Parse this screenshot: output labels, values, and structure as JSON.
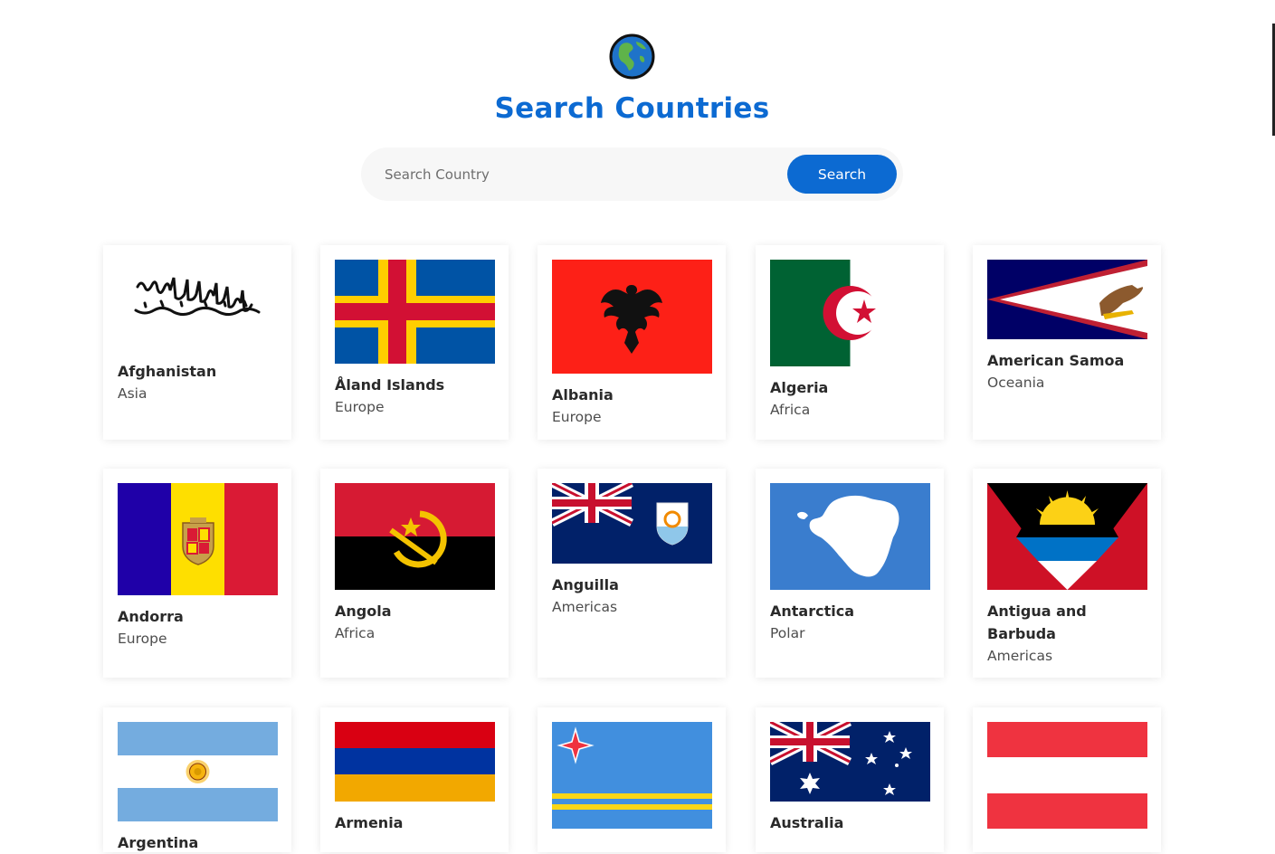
{
  "app": {
    "globe_icon": "globe-americas-icon",
    "title": "Search Countries"
  },
  "search": {
    "placeholder": "Search Country",
    "value": "",
    "button_label": "Search"
  },
  "colors": {
    "accent": "#0c6ad2",
    "search_bg": "#f7f7f7"
  },
  "countries": [
    {
      "name": "Afghanistan",
      "region": "Asia",
      "flag": "afghanistan-flag"
    },
    {
      "name": "Åland Islands",
      "region": "Europe",
      "flag": "aland-islands-flag"
    },
    {
      "name": "Albania",
      "region": "Europe",
      "flag": "albania-flag"
    },
    {
      "name": "Algeria",
      "region": "Africa",
      "flag": "algeria-flag"
    },
    {
      "name": "American Samoa",
      "region": "Oceania",
      "flag": "american-samoa-flag"
    },
    {
      "name": "Andorra",
      "region": "Europe",
      "flag": "andorra-flag"
    },
    {
      "name": "Angola",
      "region": "Africa",
      "flag": "angola-flag"
    },
    {
      "name": "Anguilla",
      "region": "Americas",
      "flag": "anguilla-flag"
    },
    {
      "name": "Antarctica",
      "region": "Polar",
      "flag": "antarctica-flag"
    },
    {
      "name": "Antigua and Barbuda",
      "region": "Americas",
      "flag": "antigua-and-barbuda-flag"
    },
    {
      "name": "Argentina",
      "region": "",
      "flag": "argentina-flag"
    },
    {
      "name": "Armenia",
      "region": "",
      "flag": "armenia-flag"
    },
    {
      "name": "",
      "region": "",
      "flag": "aruba-flag"
    },
    {
      "name": "Australia",
      "region": "",
      "flag": "australia-flag"
    },
    {
      "name": "",
      "region": "",
      "flag": "austria-flag"
    }
  ]
}
